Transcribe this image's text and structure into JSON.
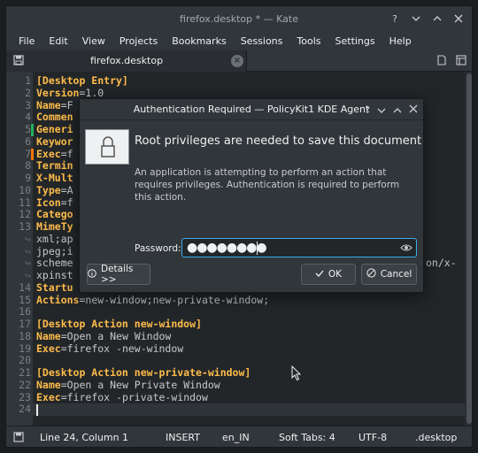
{
  "window": {
    "title": "firefox.desktop * — Kate"
  },
  "menu": [
    "File",
    "Edit",
    "View",
    "Projects",
    "Bookmarks",
    "Sessions",
    "Tools",
    "Settings",
    "Help"
  ],
  "tab": {
    "name": "firefox.desktop"
  },
  "editor": {
    "lines": [
      {
        "n": "1",
        "key": "[Desktop Entry]",
        "eq": "",
        "val": "",
        "kind": "sec"
      },
      {
        "n": "2",
        "key": "Version",
        "eq": "=",
        "val": "1.0",
        "kind": "kv"
      },
      {
        "n": "3",
        "key": "Name",
        "eq": "=",
        "val": "F",
        "kind": "kv"
      },
      {
        "n": "4",
        "key": "Commen",
        "eq": "",
        "val": "",
        "kind": "kv"
      },
      {
        "n": "5",
        "key": "Generi",
        "eq": "",
        "val": "",
        "kind": "kv"
      },
      {
        "n": "6",
        "key": "Keywor",
        "eq": "",
        "val": "",
        "kind": "kv"
      },
      {
        "n": "7",
        "key": "Exec",
        "eq": "=",
        "val": "f",
        "kind": "kv"
      },
      {
        "n": "8",
        "key": "Termin",
        "eq": "",
        "val": "",
        "kind": "kv"
      },
      {
        "n": "9",
        "key": "X-Mult",
        "eq": "",
        "val": "",
        "kind": "kv"
      },
      {
        "n": "10",
        "key": "Type",
        "eq": "=",
        "val": "A",
        "kind": "kv"
      },
      {
        "n": "11",
        "key": "Icon",
        "eq": "=",
        "val": "f",
        "kind": "kv"
      },
      {
        "n": "12",
        "key": "Catego",
        "eq": "",
        "val": "",
        "kind": "kv"
      },
      {
        "n": "13",
        "key": "MimeTy",
        "eq": "",
        "val": "",
        "kind": "kv"
      },
      {
        "n": "",
        "key": "",
        "eq": "",
        "val": "xml;ap",
        "kind": "wrap"
      },
      {
        "n": "",
        "key": "",
        "eq": "",
        "val": "jpeg;i",
        "kind": "wrap"
      },
      {
        "n": "",
        "key": "",
        "eq": "",
        "val": "scheme",
        "kind": "wrap",
        "tail": "on/x-"
      },
      {
        "n": "",
        "key": "",
        "eq": "",
        "val": "xpinst",
        "kind": "wrap"
      },
      {
        "n": "14",
        "key": "Startu",
        "eq": "",
        "val": "",
        "kind": "kv"
      },
      {
        "n": "15",
        "key": "Actions",
        "eq": "=",
        "val": "new-window;new-private-window;",
        "kind": "kv"
      },
      {
        "n": "16",
        "key": "",
        "eq": "",
        "val": "",
        "kind": "blank"
      },
      {
        "n": "17",
        "key": "[Desktop Action new-window]",
        "eq": "",
        "val": "",
        "kind": "sec"
      },
      {
        "n": "18",
        "key": "Name",
        "eq": "=",
        "val": "Open a New Window",
        "kind": "kv"
      },
      {
        "n": "19",
        "key": "Exec",
        "eq": "=",
        "val": "firefox -new-window",
        "kind": "kv"
      },
      {
        "n": "20",
        "key": "",
        "eq": "",
        "val": "",
        "kind": "blank"
      },
      {
        "n": "21",
        "key": "[Desktop Action new-private-window]",
        "eq": "",
        "val": "",
        "kind": "sec"
      },
      {
        "n": "22",
        "key": "Name",
        "eq": "=",
        "val": "Open a New Private Window",
        "kind": "kv"
      },
      {
        "n": "23",
        "key": "Exec",
        "eq": "=",
        "val": "firefox -private-window",
        "kind": "kv"
      },
      {
        "n": "24",
        "key": "",
        "eq": "",
        "val": "",
        "kind": "blank"
      }
    ]
  },
  "status": {
    "position": "Line 24, Column 1",
    "mode": "INSERT",
    "language": "en_IN",
    "indent": "Soft Tabs: 4",
    "encoding": "UTF-8",
    "filetype": ".desktop"
  },
  "dialog": {
    "title": "Authentication Required — PolicyKit1 KDE Agent",
    "heading": "Root privileges are needed to save this document",
    "description": "An application is attempting to perform an action that requires privileges. Authentication is required to perform this action.",
    "password_label": "Password:",
    "password_mask": "●●●●●●●●",
    "details_label": "Details >>",
    "ok_label": "OK",
    "cancel_label": "Cancel"
  },
  "colors": {
    "accent": "#3daee9",
    "keyword": "#fdbc4b",
    "modified_marker": "#f67400",
    "saved_marker": "#27ae60"
  }
}
